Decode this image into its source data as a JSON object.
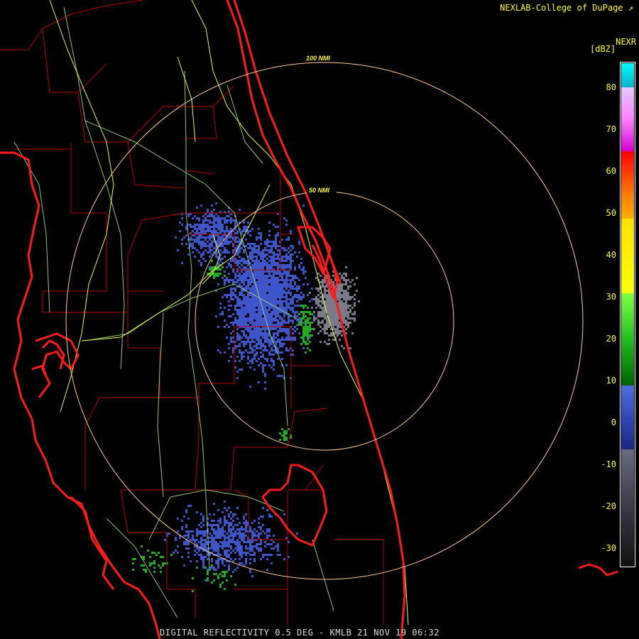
{
  "header": {
    "credit": "NEXLAB-College of DuPage",
    "product_code": "NEXR"
  },
  "legend": {
    "units": "[dBZ]",
    "ticks": [
      "80",
      "70",
      "60",
      "50",
      "40",
      "30",
      "20",
      "10",
      "0",
      "-10",
      "-20",
      "-30"
    ],
    "colors": {
      "label": "#ffff33",
      "frame": "#ffffff"
    }
  },
  "rings": [
    {
      "label": "100 NMI"
    },
    {
      "label": "50 NMI"
    }
  ],
  "caption": "DIGITAL REFLECTIVITY 0.5 DEG - KMLB 21 NOV 19 06:32",
  "map": {
    "colors": {
      "coastline": "#ff1a1a",
      "county_lines": "#b80000",
      "highways": "#e6ff4d",
      "roads": "#9be07a",
      "range_rings": "#ffcc99",
      "echo_clutter": "#7a7a8a",
      "echo_light": "#3c55c8",
      "echo_moderate": "#22aa22"
    }
  }
}
